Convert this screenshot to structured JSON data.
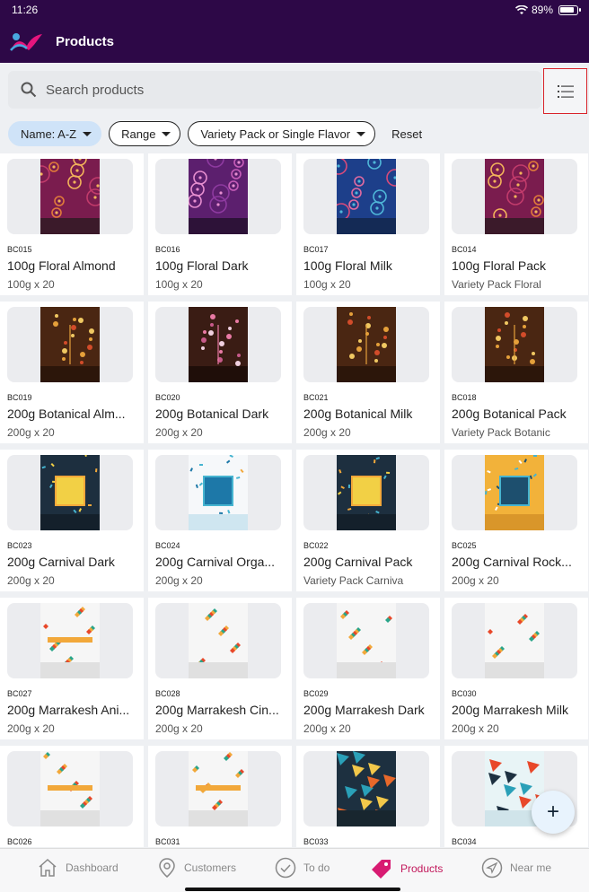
{
  "status": {
    "time": "11:26",
    "battery": "89%"
  },
  "header": {
    "title": "Products"
  },
  "search": {
    "placeholder": "Search products",
    "value": ""
  },
  "filters": {
    "sort": "Name: A-Z",
    "range": "Range",
    "variety": "Variety Pack or Single Flavor",
    "reset": "Reset"
  },
  "products": [
    {
      "code": "BC015",
      "name": "100g Floral Almond",
      "sub": "100g x 20",
      "pattern": "floral-pink"
    },
    {
      "code": "BC016",
      "name": "100g Floral Dark",
      "sub": "100g x 20",
      "pattern": "floral-purple"
    },
    {
      "code": "BC017",
      "name": "100g Floral Milk",
      "sub": "100g x 20",
      "pattern": "floral-blue"
    },
    {
      "code": "BC014",
      "name": "100g Floral Pack",
      "sub": "Variety Pack Floral",
      "pattern": "floral-pink"
    },
    {
      "code": "BC019",
      "name": "200g Botanical Alm...",
      "sub": "200g x 20",
      "pattern": "botanical"
    },
    {
      "code": "BC020",
      "name": "200g Botanical Dark",
      "sub": "200g x 20",
      "pattern": "botanical-dark"
    },
    {
      "code": "BC021",
      "name": "200g Botanical Milk",
      "sub": "200g x 20",
      "pattern": "botanical"
    },
    {
      "code": "BC018",
      "name": "200g Botanical Pack",
      "sub": "Variety Pack Botanic",
      "pattern": "botanical"
    },
    {
      "code": "BC023",
      "name": "200g Carnival Dark",
      "sub": "200g x 20",
      "pattern": "carnival-dark"
    },
    {
      "code": "BC024",
      "name": "200g Carnival Orga...",
      "sub": "200g x 20",
      "pattern": "carnival-white"
    },
    {
      "code": "BC022",
      "name": "200g Carnival Pack",
      "sub": "Variety Pack Carniva",
      "pattern": "carnival-dark"
    },
    {
      "code": "BC025",
      "name": "200g Carnival Rock...",
      "sub": "200g x 20",
      "pattern": "carnival-orange"
    },
    {
      "code": "BC027",
      "name": "200g Marrakesh Ani...",
      "sub": "200g x 20",
      "pattern": "marrakesh-skyline"
    },
    {
      "code": "BC028",
      "name": "200g Marrakesh Cin...",
      "sub": "200g x 20",
      "pattern": "marrakesh"
    },
    {
      "code": "BC029",
      "name": "200g Marrakesh Dark",
      "sub": "200g x 20",
      "pattern": "marrakesh"
    },
    {
      "code": "BC030",
      "name": "200g Marrakesh Milk",
      "sub": "200g x 20",
      "pattern": "marrakesh"
    },
    {
      "code": "BC026",
      "name": "",
      "sub": "",
      "pattern": "marrakesh-skyline"
    },
    {
      "code": "BC031",
      "name": "",
      "sub": "",
      "pattern": "marrakesh-skyline"
    },
    {
      "code": "BC033",
      "name": "",
      "sub": "",
      "pattern": "geometric-dark"
    },
    {
      "code": "BC034",
      "name": "",
      "sub": "",
      "pattern": "geometric-light"
    }
  ],
  "fab": {
    "label": "+"
  },
  "tabs": [
    {
      "label": "Dashboard",
      "icon": "home-icon",
      "active": false
    },
    {
      "label": "Customers",
      "icon": "location-pin-icon",
      "active": false
    },
    {
      "label": "To do",
      "icon": "check-circle-icon",
      "active": false
    },
    {
      "label": "Products",
      "icon": "tag-icon",
      "active": true
    },
    {
      "label": "Near me",
      "icon": "navigation-arrow-icon",
      "active": false
    }
  ],
  "colors": {
    "header": "#2d0847",
    "active_tab": "#c2185b",
    "chip_active": "#cfe3f8",
    "highlight_border": "#d9232a"
  }
}
